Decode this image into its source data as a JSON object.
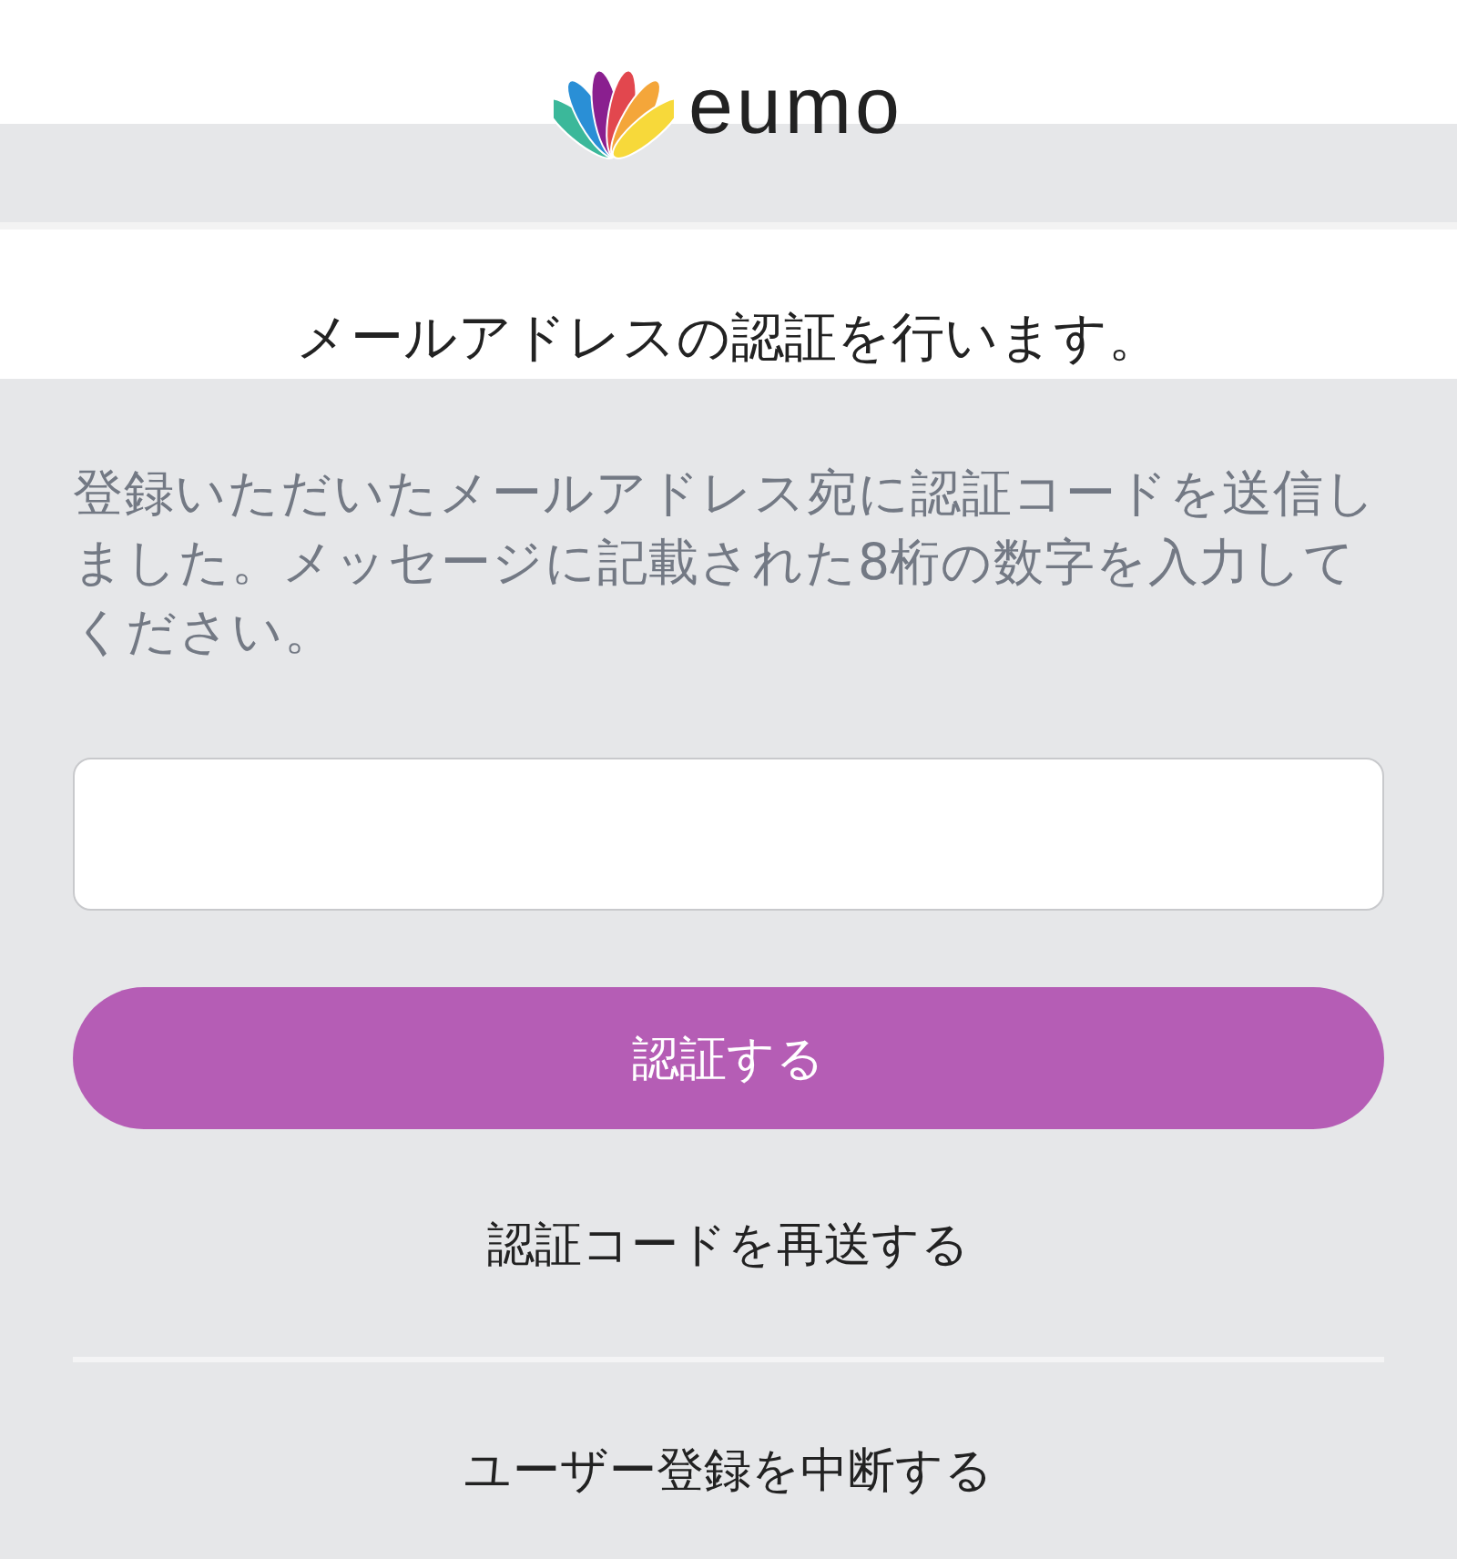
{
  "logo": {
    "wordmark": "eumo"
  },
  "heading": "メールアドレスの認証を行います。",
  "message": "登録いただいたメールアドレス宛に認証コードを送信しました。メッセージに記載された8桁の数字を入力してください。",
  "submit_button": "認証する",
  "resend_link": "認証コードを再送する",
  "cancel_link": "ユーザー登録を中断する"
}
